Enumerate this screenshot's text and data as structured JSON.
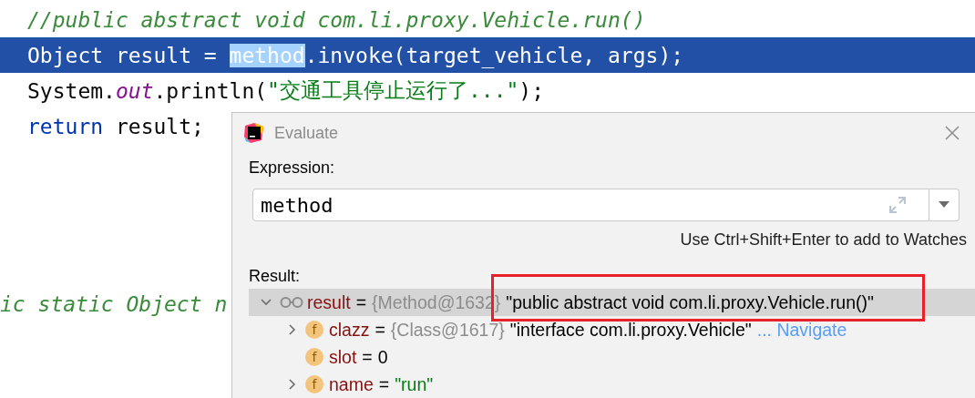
{
  "editor": {
    "lines": [
      {
        "selected": false,
        "segments": [
          {
            "text": "//public abstract void com.li.proxy.Vehicle.run()",
            "kind": "comment"
          }
        ]
      },
      {
        "selected": true,
        "segments": [
          {
            "text": "Object result = ",
            "kind": "plain"
          },
          {
            "text": "method",
            "kind": "match"
          },
          {
            "text": ".invoke(target_vehicle, args);",
            "kind": "plain"
          }
        ]
      },
      {
        "selected": false,
        "segments": [
          {
            "text": "System.",
            "kind": "plain"
          },
          {
            "text": "out",
            "kind": "static"
          },
          {
            "text": ".println(",
            "kind": "plain"
          },
          {
            "text": "\"交通工具停止运行了...\"",
            "kind": "string"
          },
          {
            "text": ");",
            "kind": "plain"
          }
        ]
      },
      {
        "selected": false,
        "segments": [
          {
            "text": "return",
            "kind": "keyword"
          },
          {
            "text": " result;",
            "kind": "plain"
          }
        ]
      }
    ],
    "cut_line": {
      "text": "ic static Object n",
      "kind": "comment"
    }
  },
  "dialog": {
    "title": "Evaluate",
    "expression_label": "Expression:",
    "expression": "method",
    "hint": "Use Ctrl+Shift+Enter to add to Watches",
    "result_label": "Result:",
    "tree": [
      {
        "name": "result",
        "sign": "=",
        "ref": "{Method@1632}",
        "value": "\"public abstract void com.li.proxy.Vehicle.run()\"",
        "is_string": false,
        "expanded": true,
        "selected": true,
        "children": [
          {
            "icon": "f",
            "name": "clazz",
            "sign": "=",
            "ref": "{Class@1617}",
            "value": "\"interface com.li.proxy.Vehicle\"",
            "is_string": false,
            "link": "... Navigate",
            "expanded": false,
            "selected": false,
            "expandable": true
          },
          {
            "icon": "f",
            "name": "slot",
            "sign": "=",
            "value": "0",
            "is_string": false,
            "selected": false,
            "expandable": false
          },
          {
            "icon": "f",
            "name": "name",
            "sign": "=",
            "value": "\"run\"",
            "is_string": true,
            "expanded": false,
            "selected": false,
            "expandable": true
          }
        ]
      }
    ]
  }
}
